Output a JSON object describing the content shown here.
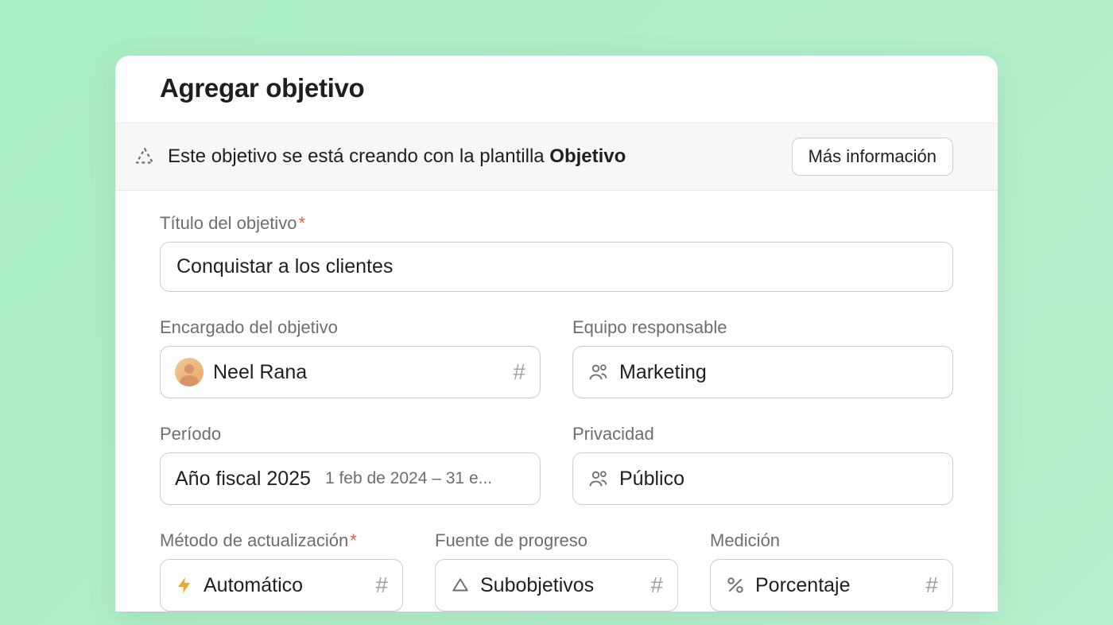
{
  "modal": {
    "title": "Agregar objetivo"
  },
  "banner": {
    "text_prefix": "Este objetivo se está creando con la plantilla ",
    "template_name": "Objetivo",
    "more_info": "Más información"
  },
  "fields": {
    "title": {
      "label": "Título del objetivo",
      "value": "Conquistar a los clientes"
    },
    "owner": {
      "label": "Encargado del objetivo",
      "value": "Neel Rana"
    },
    "team": {
      "label": "Equipo responsable",
      "value": "Marketing"
    },
    "period": {
      "label": "Período",
      "value": "Año fiscal 2025",
      "date_range": "1 feb de 2024 – 31 e..."
    },
    "privacy": {
      "label": "Privacidad",
      "value": "Público"
    },
    "update_method": {
      "label": "Método de actualización",
      "value": "Automático"
    },
    "progress_source": {
      "label": "Fuente de progreso",
      "value": "Subobjetivos"
    },
    "measurement": {
      "label": "Medición",
      "value": "Porcentaje"
    }
  }
}
